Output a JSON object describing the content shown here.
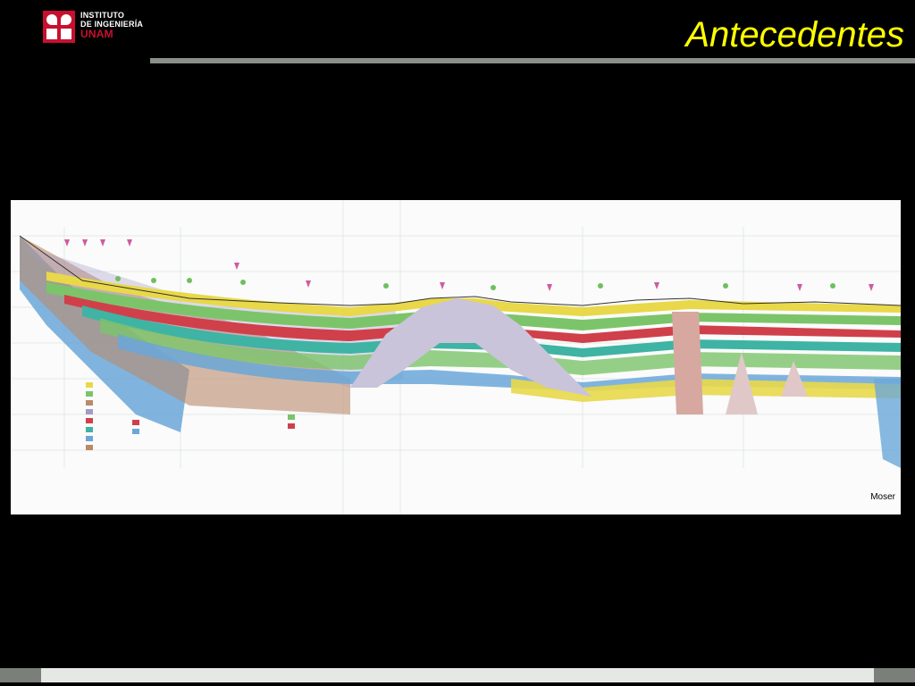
{
  "header": {
    "logo": {
      "line1": "INSTITUTO",
      "line2": "DE INGENIERÍA",
      "line3": "UNAM"
    },
    "title": "Antecedentes"
  },
  "figure": {
    "credit": "Moser",
    "colors": {
      "blue": "#6aa7d8",
      "green": "#7cc46a",
      "yellow": "#e8d84a",
      "red": "#d0404a",
      "teal": "#3fb3a4",
      "brown": "#b98a6a",
      "violet": "#a49ac8"
    }
  }
}
